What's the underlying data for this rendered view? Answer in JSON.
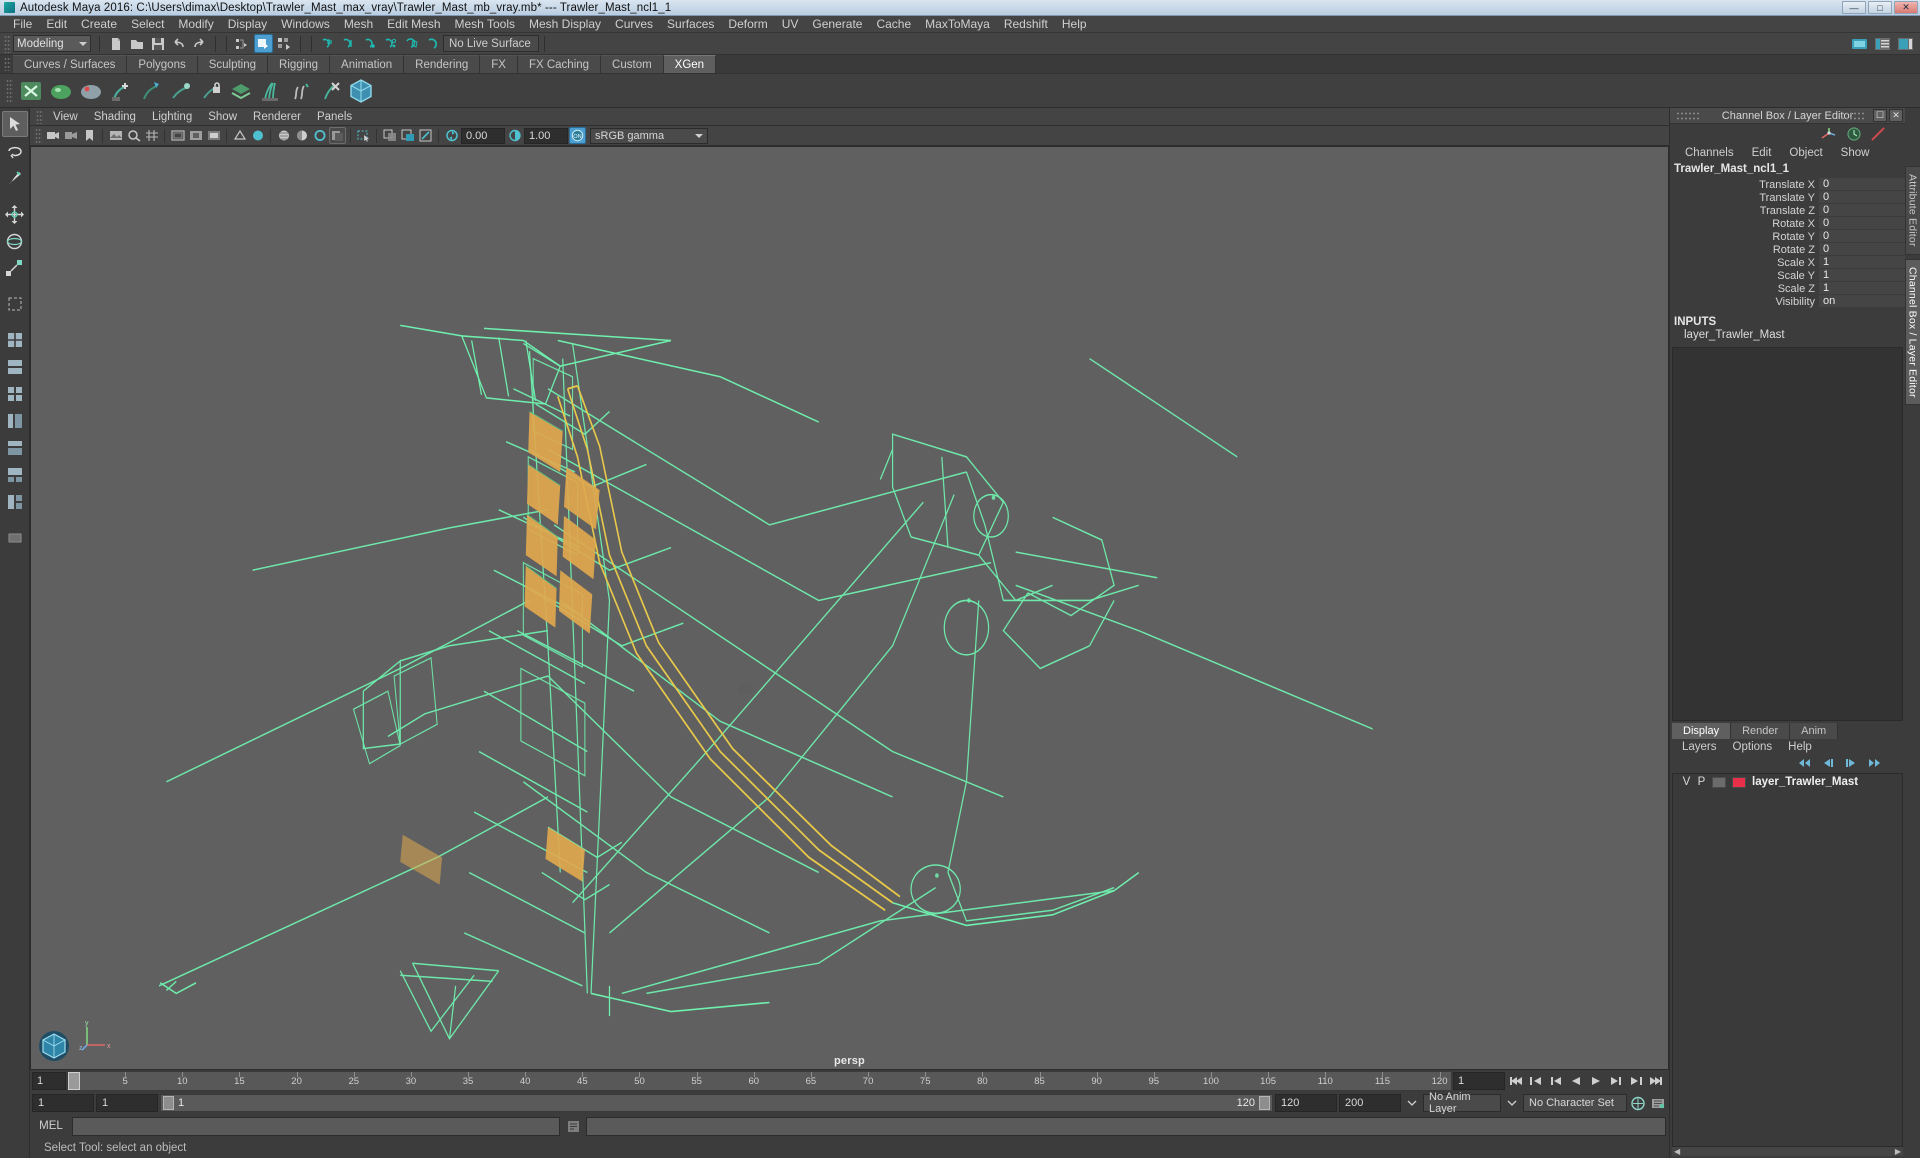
{
  "window": {
    "title": "Autodesk Maya 2016: C:\\Users\\dimax\\Desktop\\Trawler_Mast_max_vray\\Trawler_Mast_mb_vray.mb*   ---   Trawler_Mast_ncl1_1",
    "minimize": "—",
    "maximize": "□",
    "close": "✕"
  },
  "menubar": {
    "items": [
      "File",
      "Edit",
      "Create",
      "Select",
      "Modify",
      "Display",
      "Windows",
      "Mesh",
      "Edit Mesh",
      "Mesh Tools",
      "Mesh Display",
      "Curves",
      "Surfaces",
      "Deform",
      "UV",
      "Generate",
      "Cache",
      "MaxToMaya",
      "Redshift",
      "Help"
    ]
  },
  "toolbar": {
    "menuset": "Modeling",
    "live_surface": "No Live Surface"
  },
  "shelf": {
    "tabs": [
      "Curves / Surfaces",
      "Polygons",
      "Sculpting",
      "Rigging",
      "Animation",
      "Rendering",
      "FX",
      "FX Caching",
      "Custom",
      "XGen"
    ],
    "active_tab": "XGen"
  },
  "viewport": {
    "menus": [
      "View",
      "Shading",
      "Lighting",
      "Show",
      "Renderer",
      "Panels"
    ],
    "exposure": "0.00",
    "gamma_value": "1.00",
    "color_profile": "sRGB gamma",
    "camera_label": "persp",
    "wire_color": "#6ff0ae",
    "highlight_color": "#e8c84a",
    "bg_color": "#606060"
  },
  "timeslider": {
    "start_frame": "1",
    "current_frame": "1",
    "ticks": [
      "5",
      "10",
      "15",
      "20",
      "25",
      "30",
      "35",
      "40",
      "45",
      "50",
      "55",
      "60",
      "65",
      "70",
      "75",
      "80",
      "85",
      "90",
      "95",
      "100",
      "105",
      "110",
      "115",
      "120"
    ]
  },
  "rangeslider": {
    "anim_start": "1",
    "range_start": "1",
    "range_inner_start": "1",
    "range_inner_end": "120",
    "range_end": "120",
    "anim_end": "200",
    "anim_layer": "No Anim Layer",
    "character_set": "No Character Set"
  },
  "commandline": {
    "language": "MEL",
    "input_value": "",
    "output_value": ""
  },
  "status": {
    "message": "Select Tool: select an object"
  },
  "channelbox": {
    "panel_title": "Channel Box / Layer Editor",
    "menus": [
      "Channels",
      "Edit",
      "Object",
      "Show"
    ],
    "object_name": "Trawler_Mast_ncl1_1",
    "attributes": [
      {
        "label": "Translate X",
        "value": "0"
      },
      {
        "label": "Translate Y",
        "value": "0"
      },
      {
        "label": "Translate Z",
        "value": "0"
      },
      {
        "label": "Rotate X",
        "value": "0"
      },
      {
        "label": "Rotate Y",
        "value": "0"
      },
      {
        "label": "Rotate Z",
        "value": "0"
      },
      {
        "label": "Scale X",
        "value": "1"
      },
      {
        "label": "Scale Y",
        "value": "1"
      },
      {
        "label": "Scale Z",
        "value": "1"
      },
      {
        "label": "Visibility",
        "value": "on"
      }
    ],
    "inputs_header": "INPUTS",
    "inputs": [
      "layer_Trawler_Mast"
    ]
  },
  "layereditor": {
    "tabs": [
      "Display",
      "Render",
      "Anim"
    ],
    "active_tab": "Display",
    "menus": [
      "Layers",
      "Options",
      "Help"
    ],
    "layers": [
      {
        "visible": "V",
        "playback": "P",
        "name": "layer_Trawler_Mast",
        "color": "#e8304a"
      }
    ]
  },
  "sidetabs": {
    "items": [
      "Attribute Editor",
      "Channel Box / Layer Editor"
    ],
    "active": "Channel Box / Layer Editor"
  }
}
